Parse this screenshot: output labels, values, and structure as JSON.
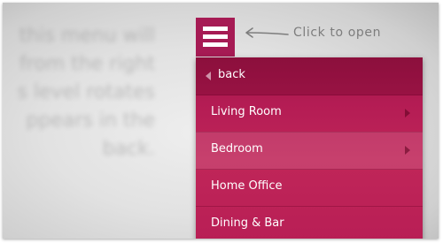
{
  "background_text": "this menu will\nfrom the right\ns level rotates\nppears in the\nback.",
  "hint": {
    "text": "Click to open",
    "icon": "arrow-left-icon"
  },
  "menu_button": {
    "icon": "hamburger-menu-icon"
  },
  "menu": {
    "back": {
      "label": "back",
      "icon": "back-arrow-icon"
    },
    "items": [
      {
        "label": "Living Room",
        "has_submenu": true
      },
      {
        "label": "Bedroom",
        "has_submenu": true
      },
      {
        "label": "Home Office",
        "has_submenu": false
      },
      {
        "label": "Dining & Bar",
        "has_submenu": false
      }
    ]
  },
  "colors": {
    "accent": "#a61b54",
    "menu_bg": "#b81e55",
    "menu_text": "#ffffff",
    "hint_text": "#7d7d7d"
  }
}
